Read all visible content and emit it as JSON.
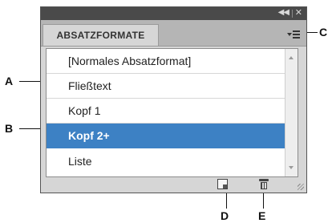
{
  "callouts": {
    "a": "A",
    "b": "B",
    "c": "C",
    "d": "D",
    "e": "E"
  },
  "panel": {
    "title_controls": {
      "collapse_icon": "double-chevron-left-icon",
      "close_icon": "close-icon"
    },
    "tab_label": "ABSATZFORMATE",
    "menu_icon": "panel-menu-icon",
    "styles": [
      {
        "label": "[Normales Absatzformat]",
        "selected": false
      },
      {
        "label": "Fließtext",
        "selected": false
      },
      {
        "label": "Kopf 1",
        "selected": false
      },
      {
        "label": "Kopf 2+",
        "selected": true
      },
      {
        "label": "Liste",
        "selected": false
      }
    ],
    "buttons": {
      "new_style_icon": "new-style-icon",
      "delete_icon": "trash-icon"
    },
    "colors": {
      "selection": "#3d81c4",
      "titlebar": "#4a4a4a",
      "panel": "#d6d6d6"
    }
  }
}
